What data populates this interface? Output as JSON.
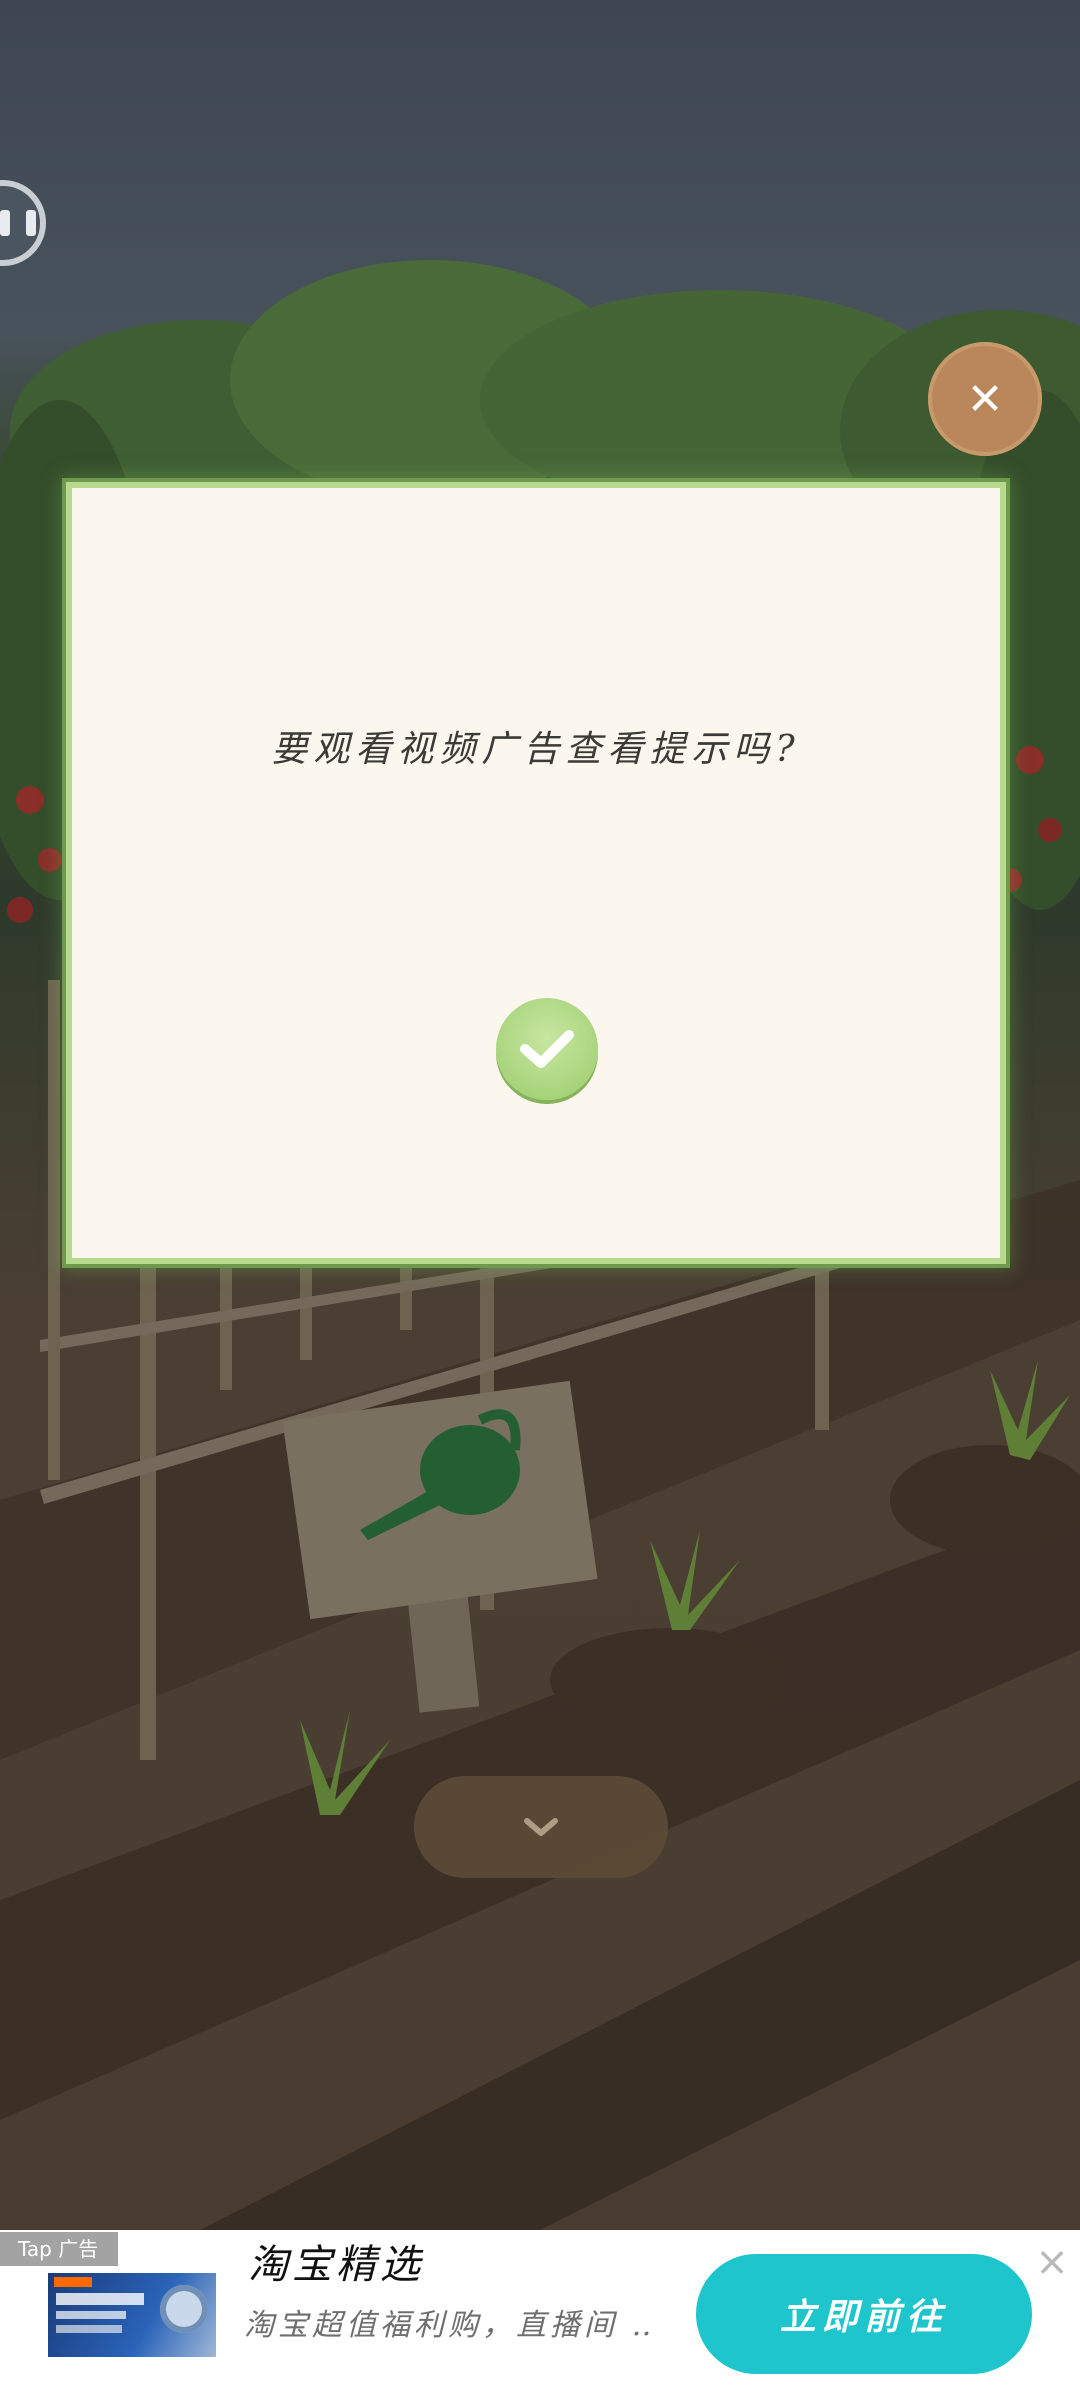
{
  "dialog": {
    "message": "要观看视频广告查看提示吗?",
    "confirm_icon": "checkmark-icon"
  },
  "controls": {
    "pause_icon": "pause-icon",
    "close_icon": "close-icon",
    "expand_icon": "chevron-down-icon"
  },
  "ad": {
    "tag": "Tap 广告",
    "title": "淘宝精选",
    "description": "淘宝超值福利购，直播间 …",
    "cta_label": "立即前往",
    "close_icon": "close-icon"
  },
  "colors": {
    "dialog_bg": "#fbf7ee",
    "dialog_border": "#b7d98b",
    "confirm_green": "#a8d47c",
    "close_brown": "#b9875b",
    "cta_teal": "#1ec5cc"
  }
}
